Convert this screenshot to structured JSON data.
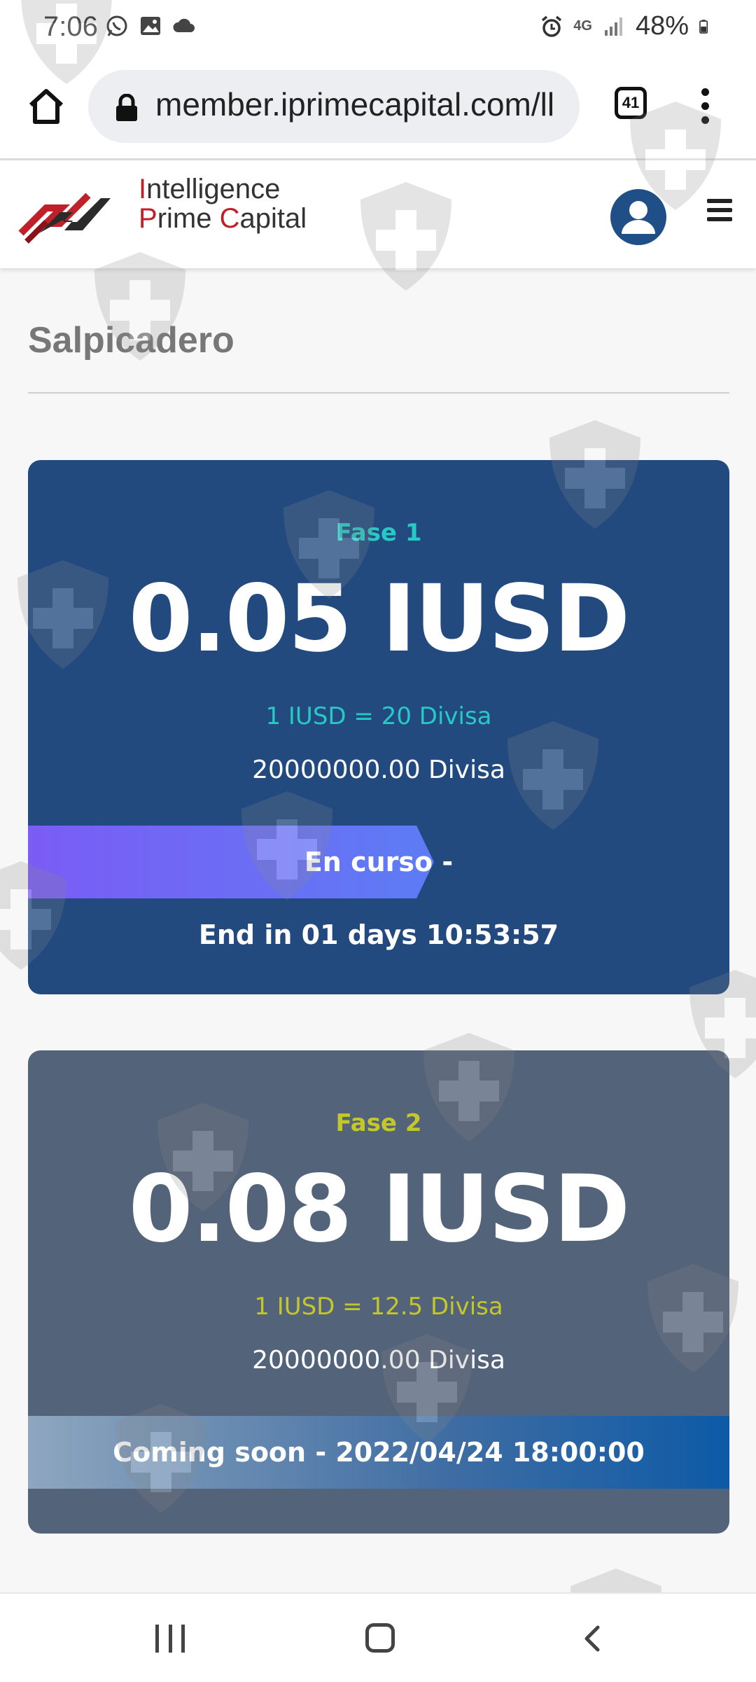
{
  "status_bar": {
    "time": "7:06",
    "battery": "48%",
    "network": "4G",
    "left_icons": [
      "whatsapp-icon",
      "gallery-icon",
      "cloud-icon"
    ],
    "right_icons": [
      "alarm-icon",
      "data-arrows-icon",
      "signal-icon",
      "battery-icon"
    ]
  },
  "browser": {
    "url": "member.iprimecapital.com/ll",
    "tab_count": "41"
  },
  "site": {
    "logo_line1": "Intelligence",
    "logo_line2": "Prime Capital",
    "logo_word1_first": "I",
    "logo_word1_rest": "ntelligence",
    "logo_word2_first": "P",
    "logo_word2_mid": "rime ",
    "logo_word3_first": "C",
    "logo_word3_rest": "apital"
  },
  "page": {
    "title": "Salpicadero"
  },
  "phases": [
    {
      "label": "Fase 1",
      "price": "0.05 IUSD",
      "rate": "1 IUSD = 20 Divisa",
      "supply": "20000000.00 Divisa",
      "status": "En curso -",
      "countdown": "End in 01 days 10:53:57",
      "label_color": "#27c9c4",
      "rate_color": "#27c9c4"
    },
    {
      "label": "Fase 2",
      "price": "0.08 IUSD",
      "rate": "1 IUSD = 12.5 Divisa",
      "supply": "20000000.00 Divisa",
      "status": "Coming soon - 2022/04/24 18:00:00",
      "label_color": "#c4c72a",
      "rate_color": "#c4c72a"
    }
  ],
  "colors": {
    "card1_bg": "#234a7f",
    "card2_bg": "#53637a",
    "brand_red": "#c0202a",
    "avatar_bg": "#1f4f86"
  },
  "nav_bar": {
    "icons": [
      "recents-icon",
      "home-icon",
      "back-icon"
    ]
  }
}
